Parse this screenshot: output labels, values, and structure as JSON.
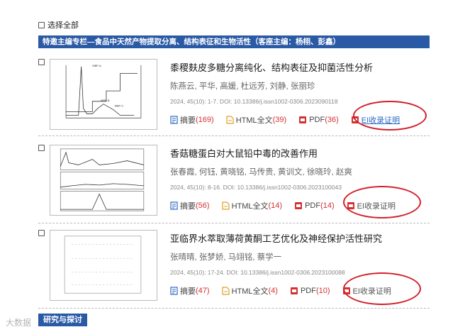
{
  "select_all_label": "选择全部",
  "banner_text": "特邀主编专栏—食品中天然产物提取分离、结构表征和生物活性（客座主编：杨栩、彭鑫）",
  "articles": [
    {
      "title": "黍稷麸皮多糖分离纯化、结构表征及抑菌活性分析",
      "authors": "陈燕云, 平华, 高媛, 杜远芳, 刘静, 张丽珍",
      "citation": "2024, 45(10): 1-7. DOI: 10.13386/j.issn1002-0306.2023090118",
      "abstract_label": "摘要",
      "abstract_count": "(169)",
      "html_label": "HTML全文",
      "html_count": "(39)",
      "pdf_label": "PDF",
      "pdf_count": "(36)",
      "ei_label": "EI收录证明",
      "thumb_labels": [
        "MBP-A",
        "MBP-B",
        "MBP-C"
      ]
    },
    {
      "title": "香菇糖蛋白对大鼠铅中毒的改善作用",
      "authors": "张春霞, 何钰, 黄晓铭, 马传贵, 黄训文, 徐晓玲, 赵爽",
      "citation": "2024, 45(10): 8-16. DOI: 10.13386/j.issn1002-0306.2023100043",
      "abstract_label": "摘要",
      "abstract_count": "(56)",
      "html_label": "HTML全文",
      "html_count": "(14)",
      "pdf_label": "PDF",
      "pdf_count": "(14)",
      "ei_label": "EI收录证明"
    },
    {
      "title": "亚临界水萃取薄荷黄酮工艺优化及神经保护活性研究",
      "authors": "张晴晴, 张梦娇, 马翊铭, 蔡学一",
      "citation": "2024, 45(10): 17-24. DOI: 10.13386/j.issn1002-0306.2023100088",
      "abstract_label": "摘要",
      "abstract_count": "(47)",
      "html_label": "HTML全文",
      "html_count": "(4)",
      "pdf_label": "PDF",
      "pdf_count": "(10)",
      "ei_label": "EI收录证明"
    }
  ],
  "bottom_tag": "研究与探讨",
  "watermark": "大数据",
  "colors": {
    "banner": "#2a5aa6",
    "count": "#d43232",
    "oval": "#d21f2a",
    "ei_link": "#2a6ac4"
  }
}
